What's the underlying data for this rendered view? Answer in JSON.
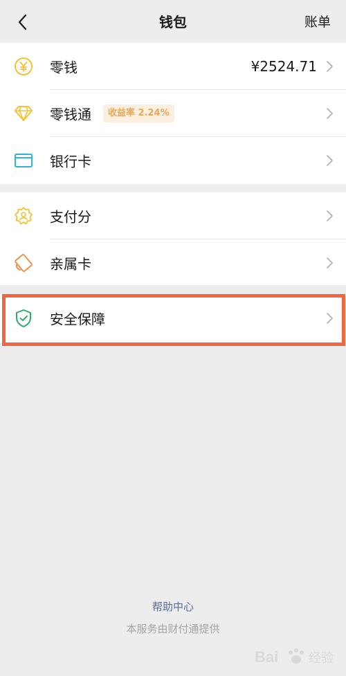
{
  "header": {
    "title": "钱包",
    "bill_label": "账单"
  },
  "group1": [
    {
      "label": "零钱",
      "value": "¥2524.71",
      "icon": "coin-yuan-icon"
    },
    {
      "label": "零钱通",
      "badge": "收益率 2.24%",
      "icon": "diamond-icon"
    },
    {
      "label": "银行卡",
      "icon": "bank-card-icon"
    }
  ],
  "group2": [
    {
      "label": "支付分",
      "icon": "payment-score-icon"
    },
    {
      "label": "亲属卡",
      "icon": "family-card-icon"
    }
  ],
  "group3": [
    {
      "label": "安全保障",
      "icon": "security-shield-icon"
    }
  ],
  "footer": {
    "help_link": "帮助中心",
    "provider_note": "本服务由财付通提供"
  },
  "watermark": {
    "text": "Bai 经验"
  },
  "colors": {
    "background": "#ededed",
    "coin_yellow": "#f2c230",
    "card_blue": "#2fb5d9",
    "shield_green": "#2aae67",
    "highlight_border": "#f0673f",
    "link_blue": "#576b95"
  }
}
